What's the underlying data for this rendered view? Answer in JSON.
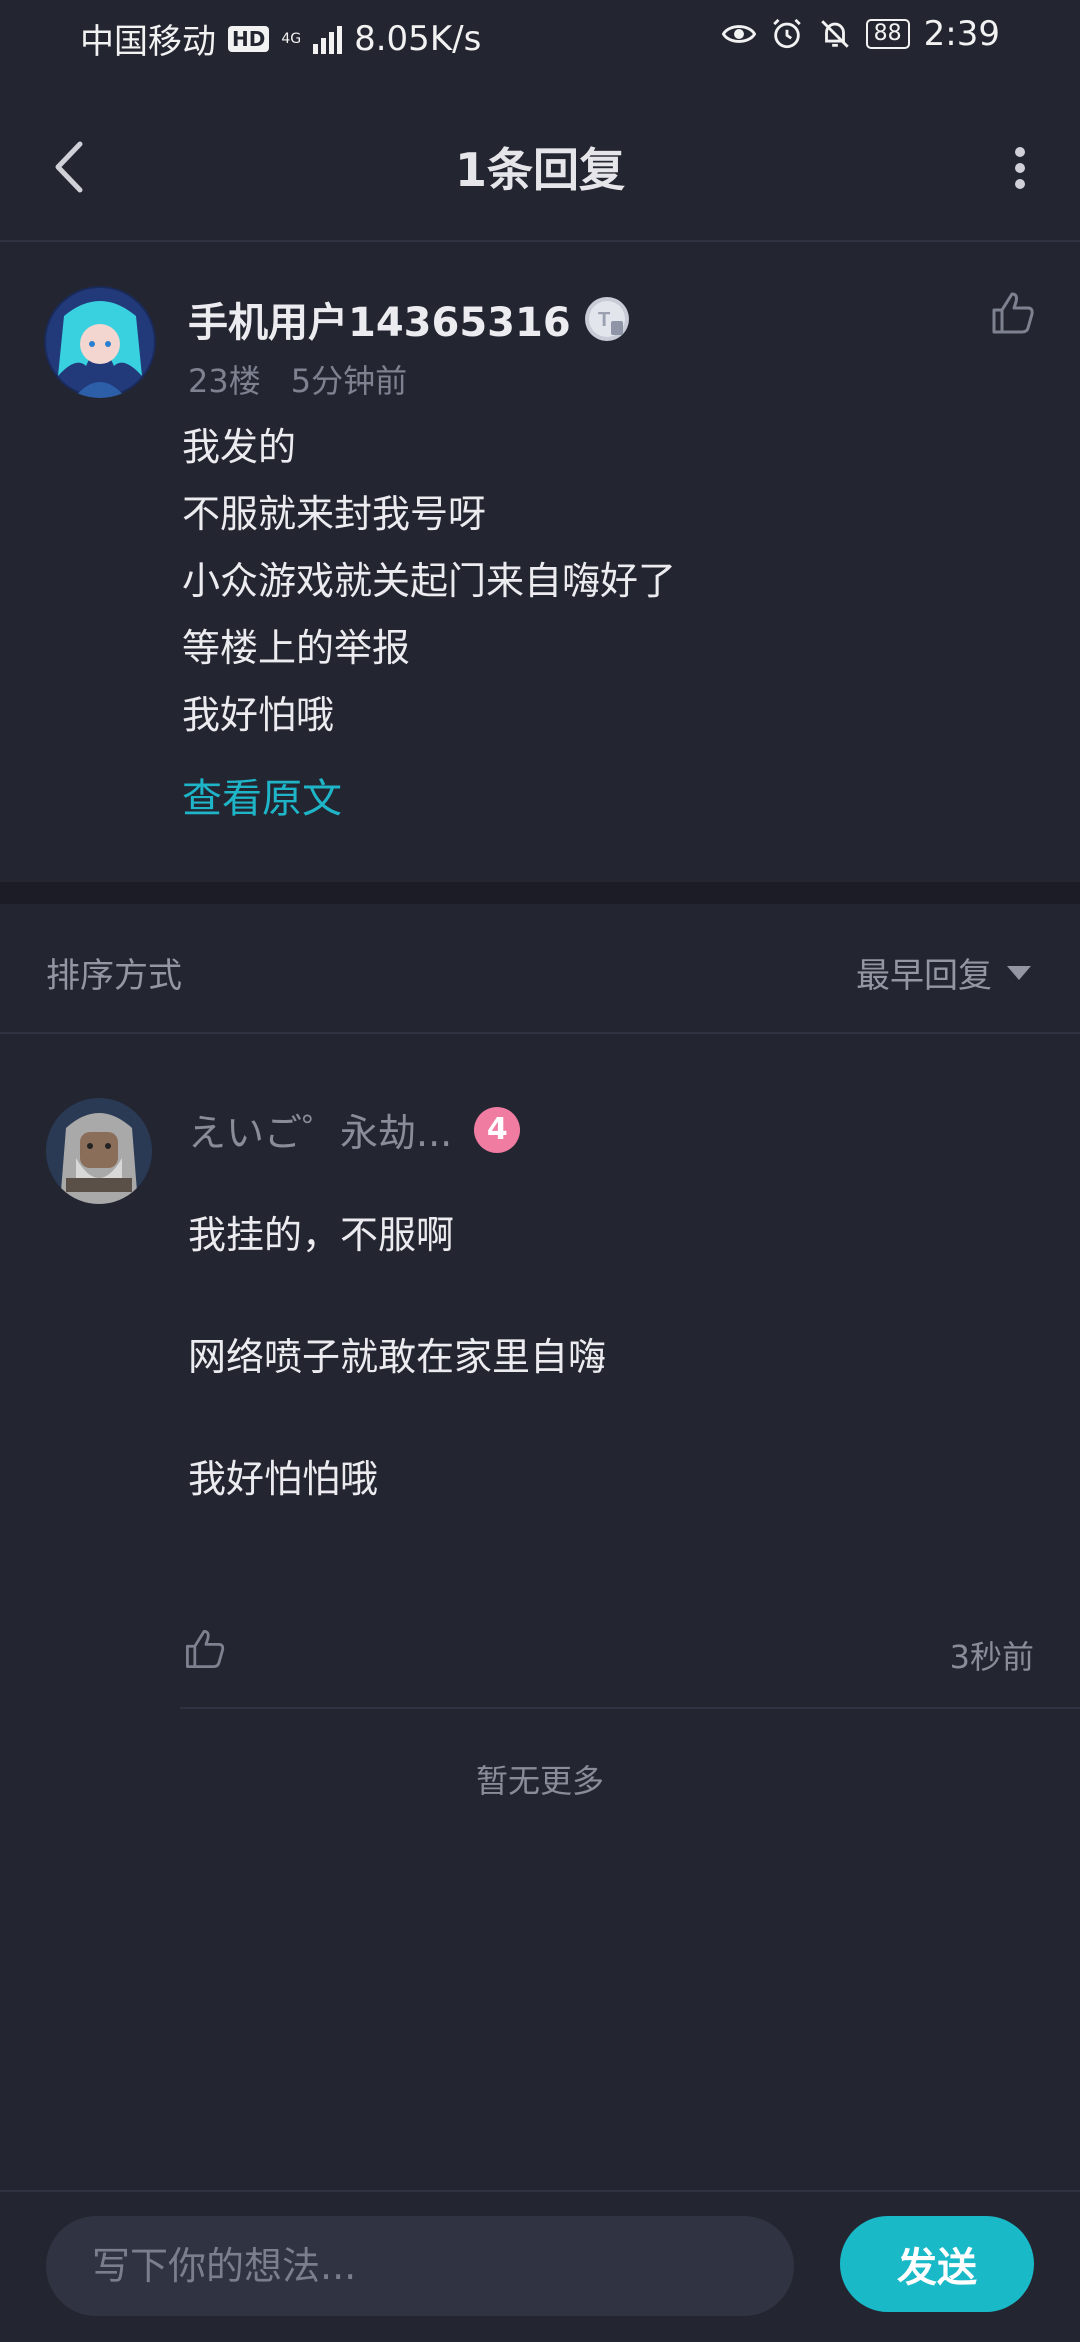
{
  "status_bar": {
    "carrier": "中国移动",
    "hd": "HD",
    "network": "4G",
    "speed": "8.05K/s",
    "battery": "88",
    "time": "2:39"
  },
  "header": {
    "title": "1条回复"
  },
  "post": {
    "username": "手机用户14365316",
    "floor": "23楼",
    "time_ago": "5分钟前",
    "lines": [
      "我发的",
      "不服就来封我号呀",
      "小众游戏就关起门来自嗨好了",
      "等楼上的举报",
      "我好怕哦"
    ],
    "view_original": "查看原文"
  },
  "sort": {
    "label": "排序方式",
    "selected": "最早回复"
  },
  "reply": {
    "username": "えいご゜永劫...",
    "level": "4",
    "lines": [
      "我挂的，不服啊",
      "网络喷子就敢在家里自嗨",
      "我好怕怕哦"
    ],
    "time_ago": "3秒前"
  },
  "footer_note": "暂无更多",
  "input": {
    "placeholder": "写下你的想法..."
  },
  "send_label": "发送",
  "colors": {
    "background": "#232530",
    "accent": "#19b9c8",
    "level_badge": "#f07ca2"
  }
}
